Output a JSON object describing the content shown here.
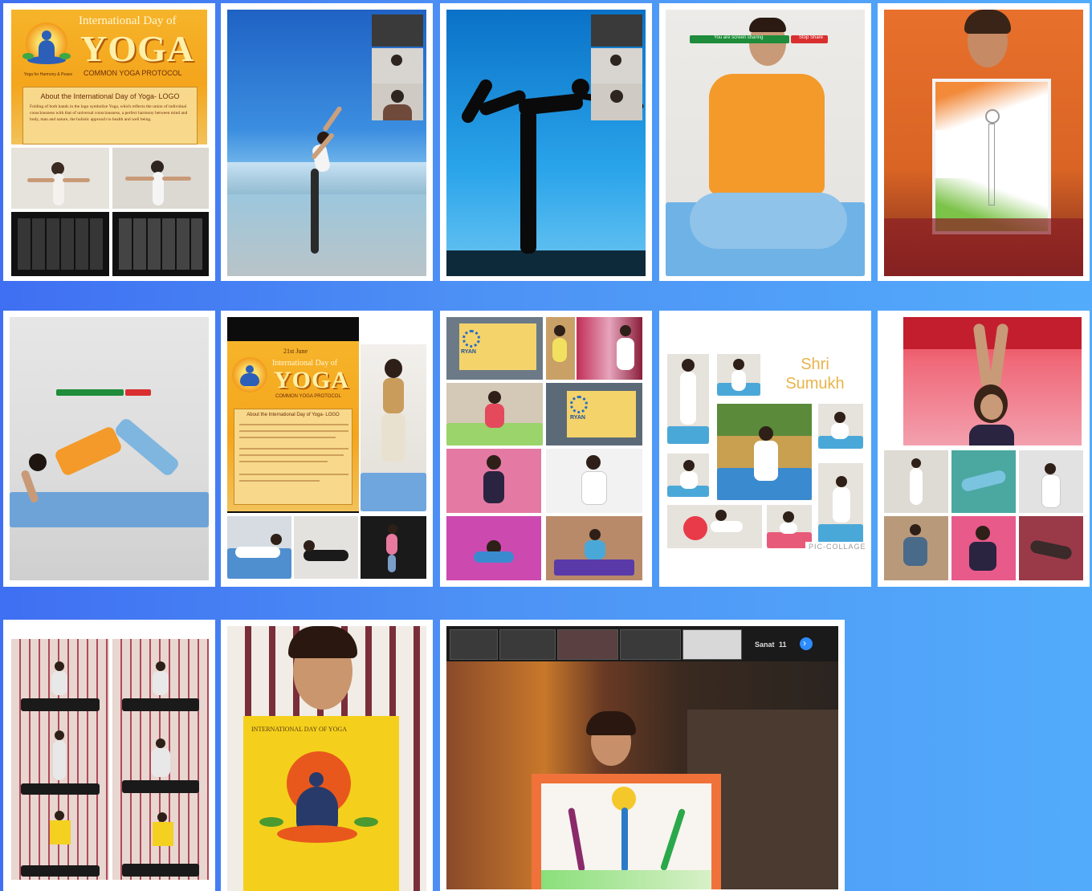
{
  "poster": {
    "title_top": "International Day of",
    "title_main": "YOGA",
    "subtitle": "COMMON YOGA PROTOCOL",
    "logo_tagline": "Yoga for Harmony & Peace",
    "about_heading": "About the International Day of Yoga- LOGO",
    "body_text": "Folding of both hands in the logo symbolize Yoga, which reflects the union of individual consciousness with that of universal consciousness, a perfect harmony between mind and body, man and nature, the holistic approach to health and well being.",
    "date_label": "21st June"
  },
  "video_call": {
    "stop_share_label": "Stop Share",
    "sharing_label": "You are screen sharing",
    "participant_name": "Sanat",
    "participant_count": "11"
  },
  "collage": {
    "name_line1": "Shri",
    "name_line2": "Sumukh",
    "watermark": "PIC-COLLAGE"
  },
  "drawing": {
    "caption": "INTERNATIONAL DAY OF YOGA"
  },
  "school_banner": {
    "label": "RYAN"
  },
  "colors": {
    "background_left": "#3f6ff2",
    "background_right": "#53acfb",
    "poster_orange": "#f4a51c",
    "zoom_green": "#1e8c3a",
    "zoom_red": "#d92f2f"
  }
}
